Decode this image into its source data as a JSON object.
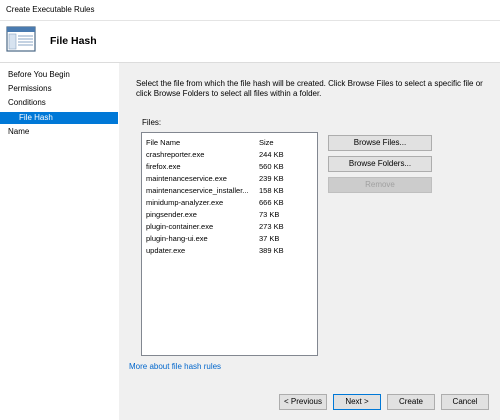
{
  "window": {
    "title": "Create Executable Rules"
  },
  "header": {
    "title": "File Hash",
    "icon": "window-list-icon"
  },
  "nav": {
    "items": [
      {
        "label": "Before You Begin",
        "selected": false,
        "sub": false
      },
      {
        "label": "Permissions",
        "selected": false,
        "sub": false
      },
      {
        "label": "Conditions",
        "selected": false,
        "sub": false
      },
      {
        "label": "File Hash",
        "selected": true,
        "sub": true
      },
      {
        "label": "Name",
        "selected": false,
        "sub": false
      }
    ]
  },
  "main": {
    "description": "Select the file from which the file hash will be created. Click Browse Files to select a specific file or click Browse Folders to select all files within a folder.",
    "files_label": "Files:",
    "columns": {
      "name": "File Name",
      "size": "Size"
    },
    "files": [
      {
        "name": "crashreporter.exe",
        "size": "244 KB"
      },
      {
        "name": "firefox.exe",
        "size": "560 KB"
      },
      {
        "name": "maintenanceservice.exe",
        "size": "239 KB"
      },
      {
        "name": "maintenanceservice_installer...",
        "size": "158 KB"
      },
      {
        "name": "minidump-analyzer.exe",
        "size": "666 KB"
      },
      {
        "name": "pingsender.exe",
        "size": "73 KB"
      },
      {
        "name": "plugin-container.exe",
        "size": "273 KB"
      },
      {
        "name": "plugin-hang-ui.exe",
        "size": "37 KB"
      },
      {
        "name": "updater.exe",
        "size": "389 KB"
      }
    ],
    "browse_files_label": "Browse Files...",
    "browse_folders_label": "Browse Folders...",
    "remove_label": "Remove",
    "more_link": "More about file hash rules"
  },
  "footer": {
    "previous_label": "< Previous",
    "next_label": "Next >",
    "create_label": "Create",
    "cancel_label": "Cancel"
  },
  "colors": {
    "selection": "#0078d7",
    "link": "#0066cc",
    "panel": "#f0f0f0"
  }
}
